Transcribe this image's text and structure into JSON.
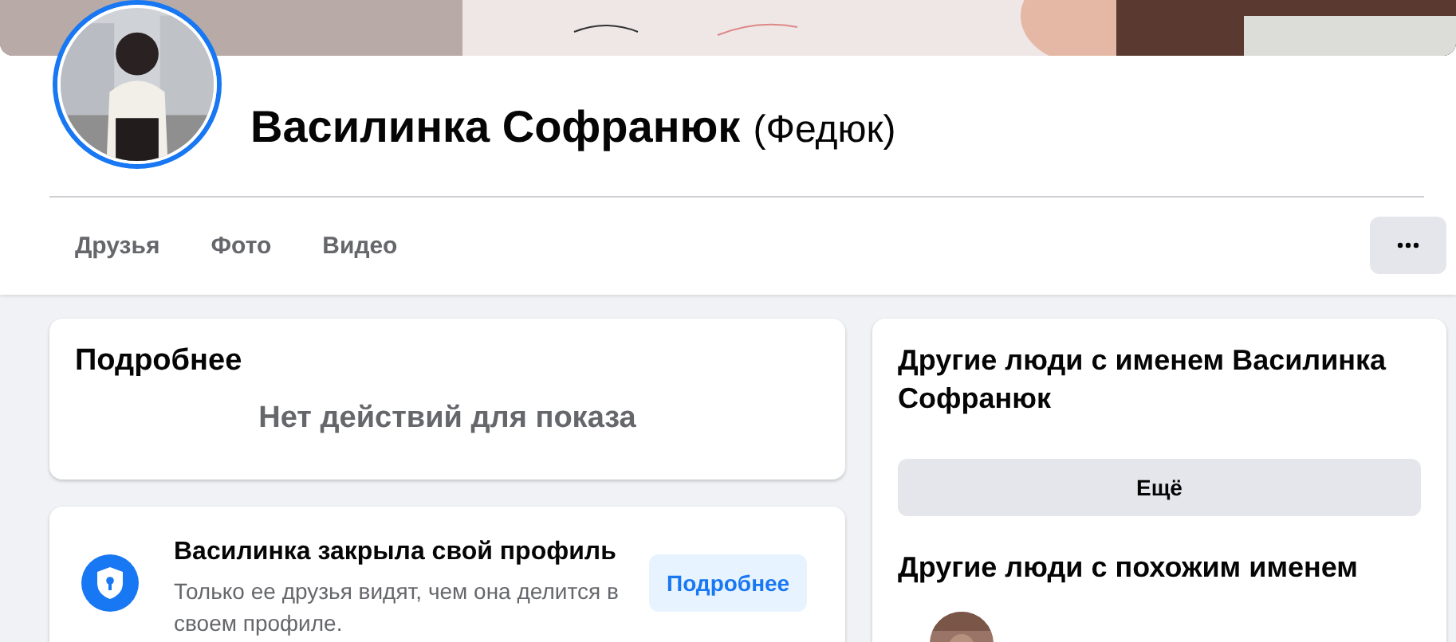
{
  "profile": {
    "name": "Василинка Софранюк",
    "alternate_name": "(Федюк)"
  },
  "tabs": [
    {
      "label": "Друзья",
      "selected": false
    },
    {
      "label": "Фото",
      "selected": false
    },
    {
      "label": "Видео",
      "selected": false
    }
  ],
  "details_card": {
    "title": "Подробнее",
    "empty_text": "Нет действий для показа"
  },
  "privacy_notice": {
    "title": "Василинка закрыла свой профиль",
    "text": "Только ее друзья видят, чем она делится в своем профиле.",
    "button": "Подробнее"
  },
  "same_name_card": {
    "title": "Другие люди с именем Василинка Софранюк",
    "button": "Ещё",
    "section_title": "Другие люди с похожим именем"
  }
}
